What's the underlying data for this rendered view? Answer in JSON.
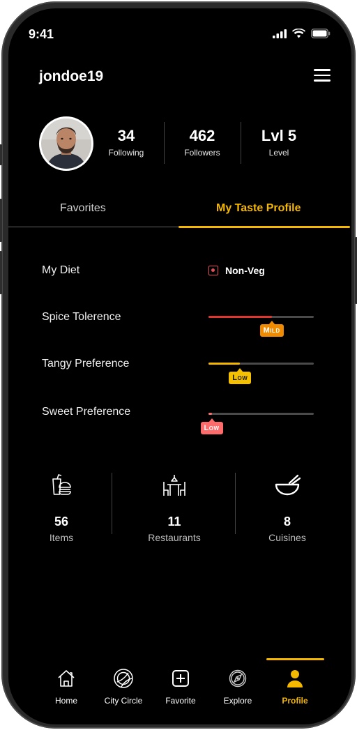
{
  "status": {
    "time": "9:41"
  },
  "header": {
    "username": "jondoe19"
  },
  "stats": [
    {
      "value": "34",
      "label": "Following"
    },
    {
      "value": "462",
      "label": "Followers"
    },
    {
      "value": "Lvl 5",
      "label": "Level"
    }
  ],
  "tabs": [
    {
      "label": "Favorites",
      "active": false
    },
    {
      "label": "My Taste Profile",
      "active": true
    }
  ],
  "taste": {
    "diet": {
      "label": "My Diet",
      "value": "Non-Veg"
    },
    "spice": {
      "label": "Spice Tolerence",
      "level": "Mild",
      "fraction": 0.6,
      "color": "#e0362f"
    },
    "tangy": {
      "label": "Tangy Preference",
      "level": "Low",
      "fraction": 0.3,
      "color": "#f5b800"
    },
    "sweet": {
      "label": "Sweet Preference",
      "level": "Low",
      "fraction": 0.03,
      "color": "#ff6b6b"
    }
  },
  "summary": [
    {
      "icon": "fast-food-icon",
      "value": "56",
      "label": "Items"
    },
    {
      "icon": "restaurant-table-icon",
      "value": "11",
      "label": "Restaurants"
    },
    {
      "icon": "bowl-icon",
      "value": "8",
      "label": "Cuisines"
    }
  ],
  "nav": [
    {
      "icon": "home-icon",
      "label": "Home"
    },
    {
      "icon": "city-circle-icon",
      "label": "City Circle"
    },
    {
      "icon": "plus-square-icon",
      "label": "Favorite"
    },
    {
      "icon": "compass-icon",
      "label": "Explore"
    },
    {
      "icon": "profile-icon",
      "label": "Profile",
      "active": true
    }
  ],
  "colors": {
    "accent": "#f5b800",
    "background": "#000000",
    "diet_nonveg": "#e24d5a"
  }
}
